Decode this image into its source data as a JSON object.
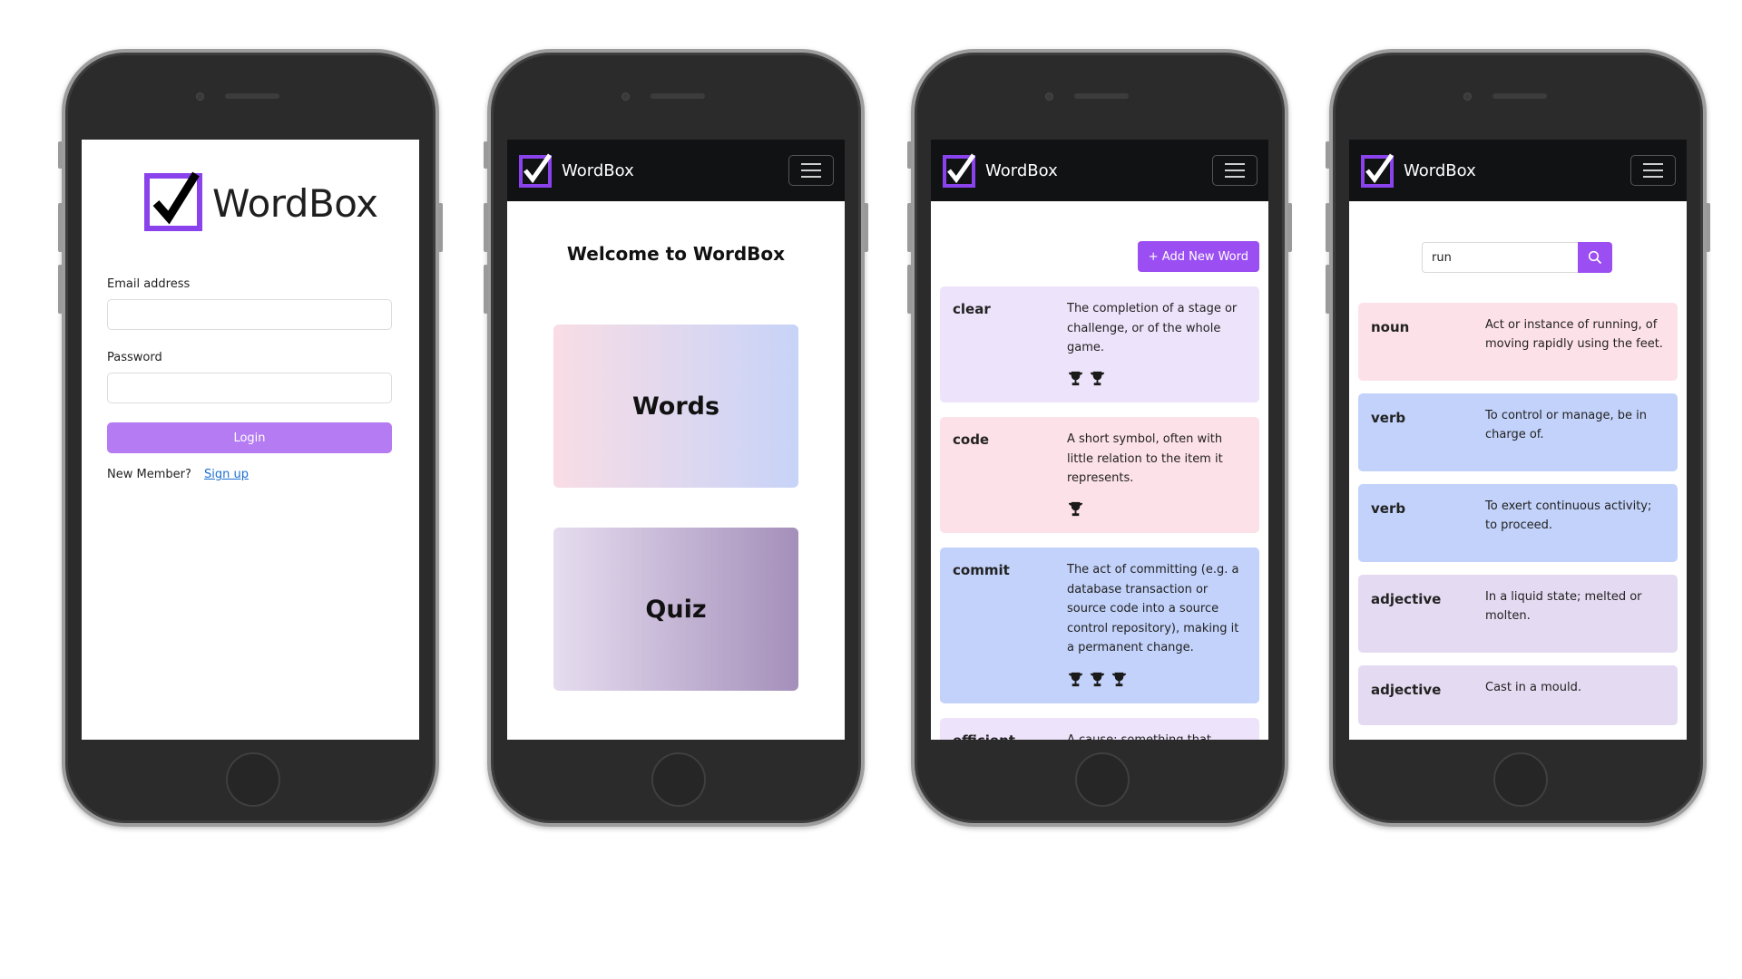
{
  "app_name": "WordBox",
  "colors": {
    "accent": "#9b4ef1",
    "login_button": "#b57bf2",
    "link": "#1a6fd1",
    "navbar": "#111214",
    "card_purple": "#ede3fa",
    "card_pink": "#fde1e8",
    "card_blue": "#c3d2fa",
    "card_lavender": "#e4daf1"
  },
  "login": {
    "email_label": "Email address",
    "email_value": "",
    "password_label": "Password",
    "password_value": "",
    "login_button": "Login",
    "new_member_text": "New Member?",
    "signup_link": "Sign up"
  },
  "home": {
    "welcome": "Welcome to WordBox",
    "words_card": "Words",
    "quiz_card": "Quiz"
  },
  "words_list": {
    "add_button": "+ Add New Word",
    "items": [
      {
        "word": "clear",
        "definition": "The completion of a stage or challenge, or of the whole game.",
        "trophies": 2,
        "color": "purple"
      },
      {
        "word": "code",
        "definition": "A short symbol, often with little relation to the item it represents.",
        "trophies": 1,
        "color": "pink"
      },
      {
        "word": "commit",
        "definition": "The act of committing (e.g. a database transaction or source code into a source control repository), making it a permanent change.",
        "trophies": 3,
        "color": "blue"
      },
      {
        "word": "efficient",
        "definition": "A cause; something that",
        "trophies": 0,
        "color": "purple"
      }
    ]
  },
  "search": {
    "query": "run",
    "icon": "search-icon",
    "results": [
      {
        "pos": "noun",
        "definition": "Act or instance of running, of moving rapidly using the feet.",
        "color": "pink"
      },
      {
        "pos": "verb",
        "definition": "To control or manage, be in charge of.",
        "color": "blue"
      },
      {
        "pos": "verb",
        "definition": "To exert continuous activity; to proceed.",
        "color": "blue"
      },
      {
        "pos": "adjective",
        "definition": "In a liquid state; melted or molten.",
        "color": "lavender"
      },
      {
        "pos": "adjective",
        "definition": "Cast in a mould.",
        "color": "lavender"
      }
    ]
  }
}
